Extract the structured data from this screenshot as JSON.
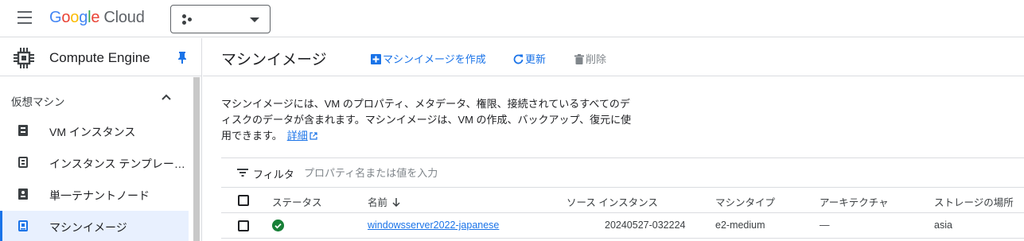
{
  "app": {
    "logo_google": "Google",
    "logo_cloud": "Cloud"
  },
  "sidebar": {
    "product_title": "Compute Engine",
    "section": "仮想マシン",
    "items": [
      {
        "label": "VM インスタンス",
        "icon": "vm-instance-icon"
      },
      {
        "label": "インスタンス テンプレー…",
        "icon": "instance-template-icon"
      },
      {
        "label": "単一テナントノード",
        "icon": "sole-tenant-node-icon"
      },
      {
        "label": "マシンイメージ",
        "icon": "machine-image-icon",
        "active": true
      }
    ]
  },
  "header": {
    "title": "マシンイメージ",
    "create_label": "マシンイメージを作成",
    "refresh_label": "更新",
    "delete_label": "削除"
  },
  "description": {
    "text": "マシンイメージには、VM のプロパティ、メタデータ、権限、接続されているすべてのディスクのデータが含まれます。マシンイメージは、VM の作成、バックアップ、復元に使用できます。",
    "link": "詳細"
  },
  "filter": {
    "label": "フィルタ",
    "placeholder": "プロパティ名または値を入力"
  },
  "table": {
    "columns": [
      "ステータス",
      "名前",
      "ソース インスタンス",
      "マシンタイプ",
      "アーキテクチャ",
      "ストレージの場所"
    ],
    "rows": [
      {
        "status": "ok",
        "name": "windowsserver2022-japanese",
        "source_instance": "20240527-032224",
        "machine_type": "e2-medium",
        "architecture": "—",
        "storage_location": "asia"
      }
    ]
  },
  "colors": {
    "accent": "#1a73e8",
    "status_ok": "#188038",
    "active_nav_bg": "#e8f0fe"
  }
}
